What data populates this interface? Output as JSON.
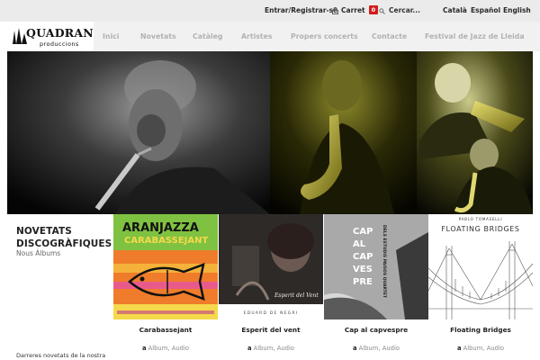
{
  "topbar": {
    "login_label": "Entrar/Registrar-se",
    "cart_label": "Carret",
    "cart_count": "0",
    "search_placeholder": "Cercar...",
    "languages": [
      "Català",
      "Español",
      "English"
    ]
  },
  "logo": {
    "name": "QUADRANT",
    "tagline": "produccions"
  },
  "nav": {
    "items": [
      "Inici",
      "Novetats",
      "Catàleg",
      "Artistes",
      "Propers concerts",
      "Contacte",
      "Festival de Jazz de Lleida"
    ]
  },
  "novetats": {
    "title_line1": "NOVETATS",
    "title_line2": "DISCOGRÀFIQUES",
    "subtitle": "Nous Àlbums",
    "description": "Darreres novetats de la nostra",
    "category_label": "Album",
    "tag_label": "Audio",
    "albums": [
      {
        "title": "Carabassejant",
        "cover_line1": "ARANJAZZA",
        "cover_line2": "CARABASSEJANT"
      },
      {
        "title": "Esperit del vent",
        "cover_caption": "Esperit del Vent",
        "cover_footer": "EDUARD DE NEGRI"
      },
      {
        "title": "Cap al capvespre",
        "cover_words": [
          "CAP",
          "AL",
          "CAP",
          "VES",
          "PRE"
        ],
        "cover_side": "DELS ESTUDIS PAISOS QUARTET"
      },
      {
        "title": "Floating Bridges",
        "cover_artist": "PABLO TOMASELLI",
        "cover_title": "FLOATING BRIDGES"
      }
    ]
  },
  "colors": {
    "accent_red": "#cf1d1d",
    "nav_text": "#b2b2b2",
    "topbar_bg": "#ebebeb",
    "hero_tint": "#9a9a1e"
  }
}
